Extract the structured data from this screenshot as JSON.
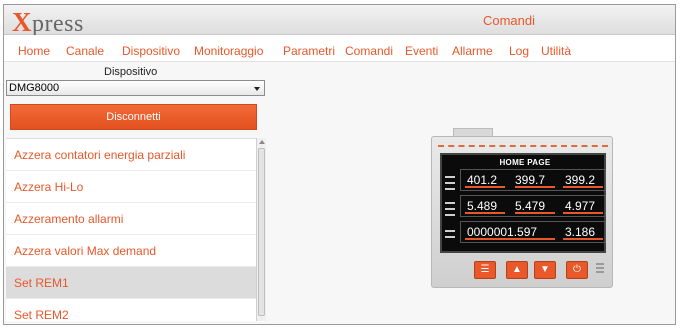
{
  "app": {
    "logo_initial": "X",
    "logo_rest": "press",
    "page_title": "Comandi",
    "accent_color": "#e8582a"
  },
  "nav": {
    "items": [
      {
        "label": "Home"
      },
      {
        "label": "Canale"
      },
      {
        "label": "Dispositivo"
      },
      {
        "label": "Monitoraggio"
      },
      {
        "label": "Parametri"
      },
      {
        "label": "Comandi"
      },
      {
        "label": "Eventi"
      },
      {
        "label": "Allarme"
      },
      {
        "label": "Log"
      },
      {
        "label": "Utilità"
      }
    ]
  },
  "device_panel": {
    "label": "Dispositivo",
    "selected_device": "DMG8000",
    "disconnect_label": "Disconnetti"
  },
  "commands": {
    "items": [
      {
        "label": "Azzera contatori energia parziali"
      },
      {
        "label": "Azzera Hi-Lo"
      },
      {
        "label": "Azzeramento allarmi"
      },
      {
        "label": "Azzera valori Max demand"
      },
      {
        "label": "Set REM1"
      },
      {
        "label": "Set REM2"
      }
    ],
    "selected_index": 4
  },
  "device_display": {
    "title": "HOME PAGE",
    "row1": [
      "401.2",
      "399.7",
      "399.2"
    ],
    "row2": [
      "5.489",
      "5.479",
      "4.977"
    ],
    "row3": [
      "0000001.597",
      "3.186"
    ],
    "buttons": [
      "menu-icon",
      "up-arrow-icon",
      "down-arrow-icon",
      "power-icon"
    ]
  }
}
